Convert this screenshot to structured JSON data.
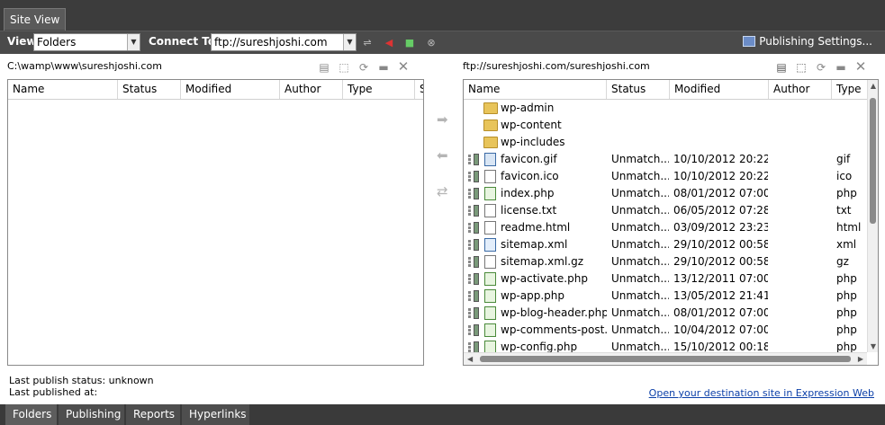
{
  "tab": {
    "site_view": "Site View"
  },
  "toolbar": {
    "view_label": "View",
    "view_value": "Folders",
    "connect_label": "Connect To:",
    "connect_value": "ftp://sureshjoshi.com",
    "publishing_settings": "Publishing Settings..."
  },
  "local": {
    "path": "C:\\wamp\\www\\sureshjoshi.com",
    "columns": [
      "Name",
      "Status",
      "Modified",
      "Author",
      "Type",
      "S"
    ]
  },
  "remote": {
    "path": "ftp://sureshjoshi.com/sureshjoshi.com",
    "columns": [
      "Name",
      "Status",
      "Modified",
      "Author",
      "Type"
    ],
    "rows": [
      {
        "kind": "folder",
        "name": "wp-admin",
        "status": "",
        "modified": "",
        "type": ""
      },
      {
        "kind": "folder",
        "name": "wp-content",
        "status": "",
        "modified": "",
        "type": ""
      },
      {
        "kind": "folder",
        "name": "wp-includes",
        "status": "",
        "modified": "",
        "type": ""
      },
      {
        "kind": "gif",
        "name": "favicon.gif",
        "status": "Unmatch...",
        "modified": "10/10/2012 20:22",
        "type": "gif"
      },
      {
        "kind": "file",
        "name": "favicon.ico",
        "status": "Unmatch...",
        "modified": "10/10/2012 20:22",
        "type": "ico"
      },
      {
        "kind": "php",
        "name": "index.php",
        "status": "Unmatch...",
        "modified": "08/01/2012 07:00",
        "type": "php"
      },
      {
        "kind": "txt",
        "name": "license.txt",
        "status": "Unmatch...",
        "modified": "06/05/2012 07:28",
        "type": "txt"
      },
      {
        "kind": "html",
        "name": "readme.html",
        "status": "Unmatch...",
        "modified": "03/09/2012 23:23",
        "type": "html"
      },
      {
        "kind": "xml",
        "name": "sitemap.xml",
        "status": "Unmatch...",
        "modified": "29/10/2012 00:58",
        "type": "xml"
      },
      {
        "kind": "file",
        "name": "sitemap.xml.gz",
        "status": "Unmatch...",
        "modified": "29/10/2012 00:58",
        "type": "gz"
      },
      {
        "kind": "php",
        "name": "wp-activate.php",
        "status": "Unmatch...",
        "modified": "13/12/2011 07:00",
        "type": "php"
      },
      {
        "kind": "php",
        "name": "wp-app.php",
        "status": "Unmatch...",
        "modified": "13/05/2012 21:41",
        "type": "php"
      },
      {
        "kind": "php",
        "name": "wp-blog-header.php",
        "status": "Unmatch...",
        "modified": "08/01/2012 07:00",
        "type": "php"
      },
      {
        "kind": "php",
        "name": "wp-comments-post...",
        "status": "Unmatch...",
        "modified": "10/04/2012 07:00",
        "type": "php"
      },
      {
        "kind": "php",
        "name": "wp-config.php",
        "status": "Unmatch...",
        "modified": "15/10/2012 00:18",
        "type": "php"
      }
    ]
  },
  "status": {
    "last_publish_status": "Last publish status: unknown",
    "last_published_at": "Last published at:",
    "open_link": "Open your destination site in Expression Web"
  },
  "bottom_tabs": [
    "Folders",
    "Publishing",
    "Reports",
    "Hyperlinks"
  ]
}
